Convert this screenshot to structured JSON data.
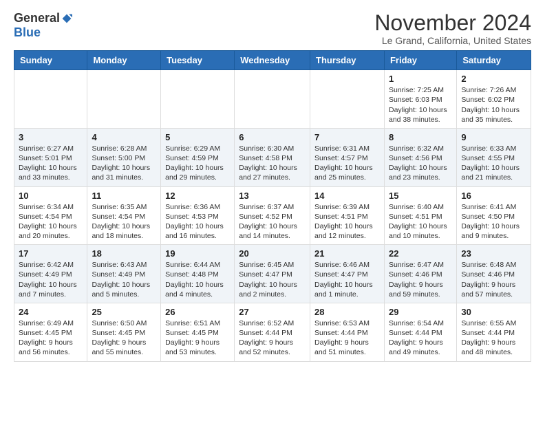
{
  "header": {
    "logo_general": "General",
    "logo_blue": "Blue",
    "month_title": "November 2024",
    "location": "Le Grand, California, United States"
  },
  "days_of_week": [
    "Sunday",
    "Monday",
    "Tuesday",
    "Wednesday",
    "Thursday",
    "Friday",
    "Saturday"
  ],
  "weeks": [
    [
      {
        "day": "",
        "info": ""
      },
      {
        "day": "",
        "info": ""
      },
      {
        "day": "",
        "info": ""
      },
      {
        "day": "",
        "info": ""
      },
      {
        "day": "",
        "info": ""
      },
      {
        "day": "1",
        "info": "Sunrise: 7:25 AM\nSunset: 6:03 PM\nDaylight: 10 hours and 38 minutes."
      },
      {
        "day": "2",
        "info": "Sunrise: 7:26 AM\nSunset: 6:02 PM\nDaylight: 10 hours and 35 minutes."
      }
    ],
    [
      {
        "day": "3",
        "info": "Sunrise: 6:27 AM\nSunset: 5:01 PM\nDaylight: 10 hours and 33 minutes."
      },
      {
        "day": "4",
        "info": "Sunrise: 6:28 AM\nSunset: 5:00 PM\nDaylight: 10 hours and 31 minutes."
      },
      {
        "day": "5",
        "info": "Sunrise: 6:29 AM\nSunset: 4:59 PM\nDaylight: 10 hours and 29 minutes."
      },
      {
        "day": "6",
        "info": "Sunrise: 6:30 AM\nSunset: 4:58 PM\nDaylight: 10 hours and 27 minutes."
      },
      {
        "day": "7",
        "info": "Sunrise: 6:31 AM\nSunset: 4:57 PM\nDaylight: 10 hours and 25 minutes."
      },
      {
        "day": "8",
        "info": "Sunrise: 6:32 AM\nSunset: 4:56 PM\nDaylight: 10 hours and 23 minutes."
      },
      {
        "day": "9",
        "info": "Sunrise: 6:33 AM\nSunset: 4:55 PM\nDaylight: 10 hours and 21 minutes."
      }
    ],
    [
      {
        "day": "10",
        "info": "Sunrise: 6:34 AM\nSunset: 4:54 PM\nDaylight: 10 hours and 20 minutes."
      },
      {
        "day": "11",
        "info": "Sunrise: 6:35 AM\nSunset: 4:54 PM\nDaylight: 10 hours and 18 minutes."
      },
      {
        "day": "12",
        "info": "Sunrise: 6:36 AM\nSunset: 4:53 PM\nDaylight: 10 hours and 16 minutes."
      },
      {
        "day": "13",
        "info": "Sunrise: 6:37 AM\nSunset: 4:52 PM\nDaylight: 10 hours and 14 minutes."
      },
      {
        "day": "14",
        "info": "Sunrise: 6:39 AM\nSunset: 4:51 PM\nDaylight: 10 hours and 12 minutes."
      },
      {
        "day": "15",
        "info": "Sunrise: 6:40 AM\nSunset: 4:51 PM\nDaylight: 10 hours and 10 minutes."
      },
      {
        "day": "16",
        "info": "Sunrise: 6:41 AM\nSunset: 4:50 PM\nDaylight: 10 hours and 9 minutes."
      }
    ],
    [
      {
        "day": "17",
        "info": "Sunrise: 6:42 AM\nSunset: 4:49 PM\nDaylight: 10 hours and 7 minutes."
      },
      {
        "day": "18",
        "info": "Sunrise: 6:43 AM\nSunset: 4:49 PM\nDaylight: 10 hours and 5 minutes."
      },
      {
        "day": "19",
        "info": "Sunrise: 6:44 AM\nSunset: 4:48 PM\nDaylight: 10 hours and 4 minutes."
      },
      {
        "day": "20",
        "info": "Sunrise: 6:45 AM\nSunset: 4:47 PM\nDaylight: 10 hours and 2 minutes."
      },
      {
        "day": "21",
        "info": "Sunrise: 6:46 AM\nSunset: 4:47 PM\nDaylight: 10 hours and 1 minute."
      },
      {
        "day": "22",
        "info": "Sunrise: 6:47 AM\nSunset: 4:46 PM\nDaylight: 9 hours and 59 minutes."
      },
      {
        "day": "23",
        "info": "Sunrise: 6:48 AM\nSunset: 4:46 PM\nDaylight: 9 hours and 57 minutes."
      }
    ],
    [
      {
        "day": "24",
        "info": "Sunrise: 6:49 AM\nSunset: 4:45 PM\nDaylight: 9 hours and 56 minutes."
      },
      {
        "day": "25",
        "info": "Sunrise: 6:50 AM\nSunset: 4:45 PM\nDaylight: 9 hours and 55 minutes."
      },
      {
        "day": "26",
        "info": "Sunrise: 6:51 AM\nSunset: 4:45 PM\nDaylight: 9 hours and 53 minutes."
      },
      {
        "day": "27",
        "info": "Sunrise: 6:52 AM\nSunset: 4:44 PM\nDaylight: 9 hours and 52 minutes."
      },
      {
        "day": "28",
        "info": "Sunrise: 6:53 AM\nSunset: 4:44 PM\nDaylight: 9 hours and 51 minutes."
      },
      {
        "day": "29",
        "info": "Sunrise: 6:54 AM\nSunset: 4:44 PM\nDaylight: 9 hours and 49 minutes."
      },
      {
        "day": "30",
        "info": "Sunrise: 6:55 AM\nSunset: 4:44 PM\nDaylight: 9 hours and 48 minutes."
      }
    ]
  ]
}
